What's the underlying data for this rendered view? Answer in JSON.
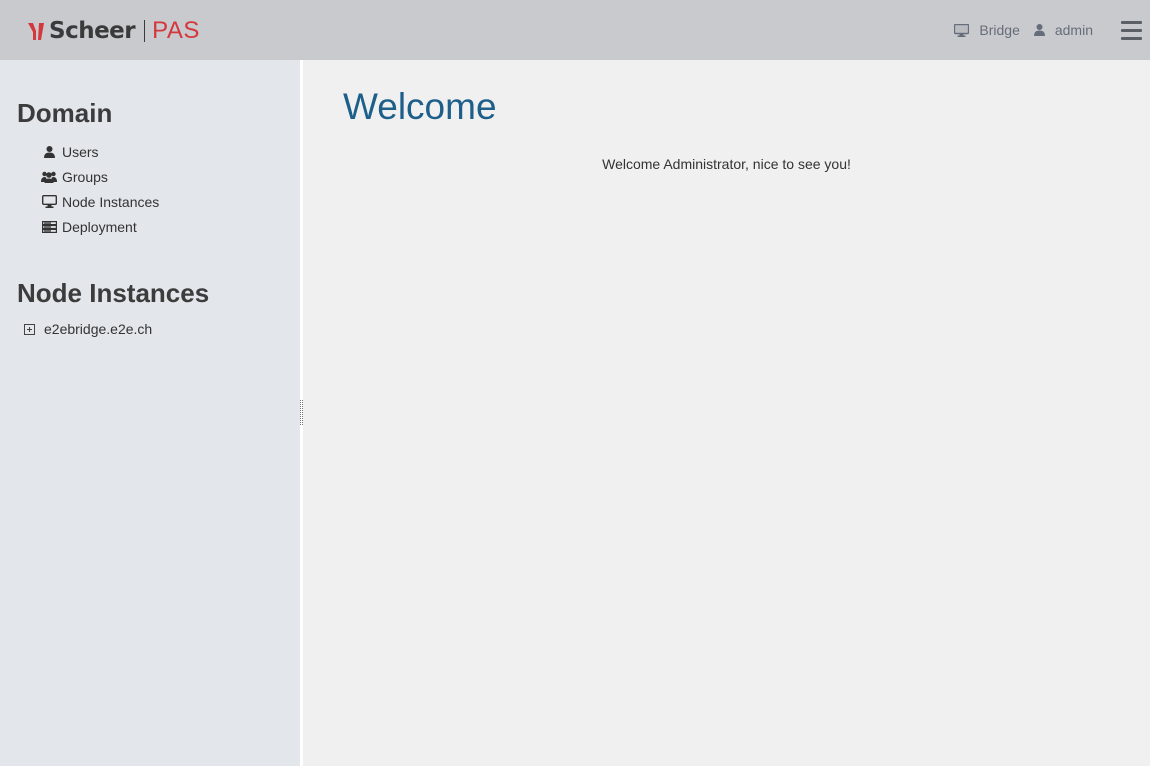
{
  "header": {
    "logo_brand": "Scheer",
    "logo_product": "PAS",
    "bridge_label": "Bridge",
    "user_label": "admin",
    "icons": {
      "bridge": "monitor-icon",
      "user": "user-icon",
      "menu": "hamburger-menu-icon"
    }
  },
  "sidebar": {
    "domain_title": "Domain",
    "items": [
      {
        "label": "Users",
        "icon": "user-icon"
      },
      {
        "label": "Groups",
        "icon": "users-icon"
      },
      {
        "label": "Node Instances",
        "icon": "monitor-icon"
      },
      {
        "label": "Deployment",
        "icon": "server-stack-icon"
      }
    ],
    "node_title": "Node Instances",
    "nodes": [
      {
        "label": "e2ebridge.e2e.ch",
        "expanded": false
      }
    ]
  },
  "main": {
    "title": "Welcome",
    "message": "Welcome Administrator, nice to see you!"
  },
  "colors": {
    "header_bg": "#c9cacd",
    "sidebar_bg": "#e3e6ea",
    "main_bg": "#f0f0f0",
    "title_blue": "#1d5f8a",
    "brand_red": "#d4373c"
  }
}
